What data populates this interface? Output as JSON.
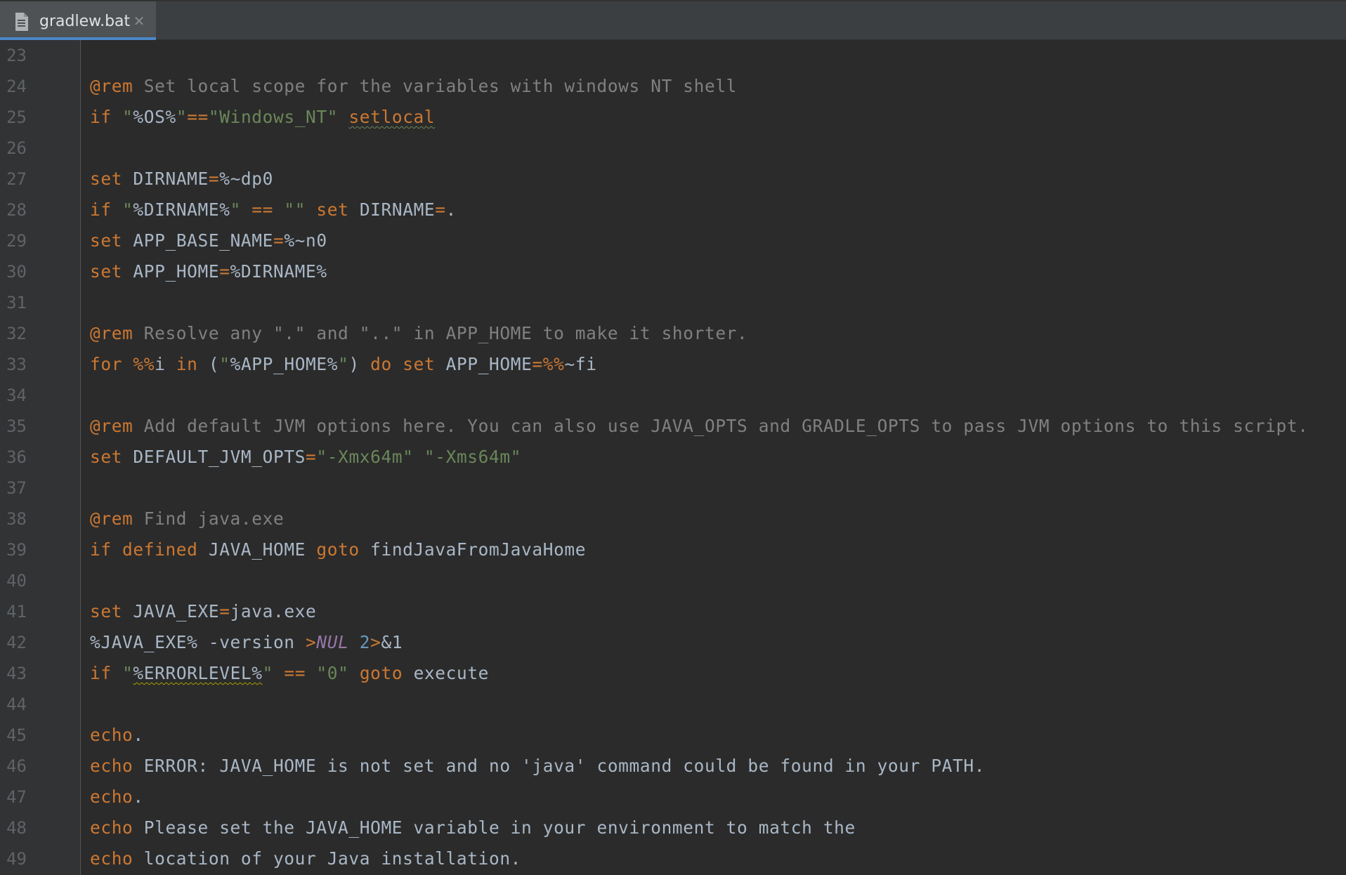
{
  "tab": {
    "filename": "gradlew.bat",
    "icon": "file-icon",
    "close_glyph": "✕"
  },
  "colors": {
    "background": "#2b2b2b",
    "gutter": "#313335",
    "keyword": "#cc7832",
    "comment": "#808080",
    "string": "#6a8759",
    "text": "#a9b7c6",
    "accent": "#4a88c7"
  },
  "lines": [
    {
      "n": "23",
      "tokens": []
    },
    {
      "n": "24",
      "tokens": [
        {
          "t": "rem",
          "v": "@rem"
        },
        {
          "t": "cm",
          "v": " Set local scope for the variables with windows NT shell"
        }
      ]
    },
    {
      "n": "25",
      "tokens": [
        {
          "t": "kw",
          "v": "if"
        },
        {
          "t": "txt",
          "v": " "
        },
        {
          "t": "str",
          "v": "\""
        },
        {
          "t": "var",
          "v": "%OS%"
        },
        {
          "t": "str",
          "v": "\""
        },
        {
          "t": "op",
          "v": "=="
        },
        {
          "t": "str",
          "v": "\"Windows_NT\""
        },
        {
          "t": "txt",
          "v": " "
        },
        {
          "t": "kw-err",
          "v": "setlocal"
        }
      ]
    },
    {
      "n": "26",
      "tokens": []
    },
    {
      "n": "27",
      "tokens": [
        {
          "t": "kw",
          "v": "set"
        },
        {
          "t": "txt",
          "v": " DIRNAME"
        },
        {
          "t": "op",
          "v": "="
        },
        {
          "t": "txt",
          "v": "%~dp0"
        }
      ]
    },
    {
      "n": "28",
      "tokens": [
        {
          "t": "kw",
          "v": "if"
        },
        {
          "t": "txt",
          "v": " "
        },
        {
          "t": "str",
          "v": "\""
        },
        {
          "t": "var",
          "v": "%DIRNAME%"
        },
        {
          "t": "str",
          "v": "\""
        },
        {
          "t": "txt",
          "v": " "
        },
        {
          "t": "op",
          "v": "=="
        },
        {
          "t": "txt",
          "v": " "
        },
        {
          "t": "str",
          "v": "\"\""
        },
        {
          "t": "txt",
          "v": " "
        },
        {
          "t": "kw",
          "v": "set"
        },
        {
          "t": "txt",
          "v": " DIRNAME"
        },
        {
          "t": "op",
          "v": "="
        },
        {
          "t": "txt",
          "v": "."
        }
      ]
    },
    {
      "n": "29",
      "tokens": [
        {
          "t": "kw",
          "v": "set"
        },
        {
          "t": "txt",
          "v": " APP_BASE_NAME"
        },
        {
          "t": "op",
          "v": "="
        },
        {
          "t": "txt",
          "v": "%~n0"
        }
      ]
    },
    {
      "n": "30",
      "tokens": [
        {
          "t": "kw",
          "v": "set"
        },
        {
          "t": "txt",
          "v": " APP_HOME"
        },
        {
          "t": "op",
          "v": "="
        },
        {
          "t": "txt",
          "v": "%DIRNAME%"
        }
      ]
    },
    {
      "n": "31",
      "tokens": []
    },
    {
      "n": "32",
      "tokens": [
        {
          "t": "rem",
          "v": "@rem"
        },
        {
          "t": "cm",
          "v": " Resolve any \".\" and \"..\" in APP_HOME to make it shorter."
        }
      ]
    },
    {
      "n": "33",
      "tokens": [
        {
          "t": "kw",
          "v": "for"
        },
        {
          "t": "txt",
          "v": " "
        },
        {
          "t": "op",
          "v": "%%"
        },
        {
          "t": "txt",
          "v": "i "
        },
        {
          "t": "kw",
          "v": "in"
        },
        {
          "t": "txt",
          "v": " ("
        },
        {
          "t": "str",
          "v": "\""
        },
        {
          "t": "var",
          "v": "%APP_HOME%"
        },
        {
          "t": "str",
          "v": "\""
        },
        {
          "t": "txt",
          "v": ") "
        },
        {
          "t": "kw",
          "v": "do"
        },
        {
          "t": "txt",
          "v": " "
        },
        {
          "t": "kw",
          "v": "set"
        },
        {
          "t": "txt",
          "v": " APP_HOME"
        },
        {
          "t": "op",
          "v": "=%%"
        },
        {
          "t": "txt",
          "v": "~fi"
        }
      ]
    },
    {
      "n": "34",
      "tokens": []
    },
    {
      "n": "35",
      "tokens": [
        {
          "t": "rem",
          "v": "@rem"
        },
        {
          "t": "cm",
          "v": " Add default JVM options here. You can also use JAVA_OPTS and GRADLE_OPTS to pass JVM options to this script."
        }
      ]
    },
    {
      "n": "36",
      "tokens": [
        {
          "t": "kw",
          "v": "set"
        },
        {
          "t": "txt",
          "v": " DEFAULT_JVM_OPTS"
        },
        {
          "t": "op",
          "v": "="
        },
        {
          "t": "str",
          "v": "\"-Xmx64m\" \"-Xms64m\""
        }
      ]
    },
    {
      "n": "37",
      "tokens": []
    },
    {
      "n": "38",
      "tokens": [
        {
          "t": "rem",
          "v": "@rem"
        },
        {
          "t": "cm",
          "v": " Find java.exe"
        }
      ]
    },
    {
      "n": "39",
      "tokens": [
        {
          "t": "kw",
          "v": "if defined"
        },
        {
          "t": "txt",
          "v": " JAVA_HOME "
        },
        {
          "t": "kw",
          "v": "goto"
        },
        {
          "t": "txt",
          "v": " findJavaFromJavaHome"
        }
      ]
    },
    {
      "n": "40",
      "tokens": []
    },
    {
      "n": "41",
      "tokens": [
        {
          "t": "kw",
          "v": "set"
        },
        {
          "t": "txt",
          "v": " JAVA_EXE"
        },
        {
          "t": "op",
          "v": "="
        },
        {
          "t": "txt",
          "v": "java.exe"
        }
      ]
    },
    {
      "n": "42",
      "tokens": [
        {
          "t": "txt",
          "v": "%JAVA_EXE% -version "
        },
        {
          "t": "op",
          "v": ">"
        },
        {
          "t": "nul",
          "v": "NUL"
        },
        {
          "t": "txt",
          "v": " "
        },
        {
          "t": "num",
          "v": "2"
        },
        {
          "t": "op",
          "v": ">"
        },
        {
          "t": "txt",
          "v": "&1"
        }
      ]
    },
    {
      "n": "43",
      "tokens": [
        {
          "t": "kw",
          "v": "if"
        },
        {
          "t": "txt",
          "v": " "
        },
        {
          "t": "str",
          "v": "\""
        },
        {
          "t": "var-warn",
          "v": "%ERRORLEVEL%"
        },
        {
          "t": "str",
          "v": "\""
        },
        {
          "t": "txt",
          "v": " "
        },
        {
          "t": "op",
          "v": "=="
        },
        {
          "t": "txt",
          "v": " "
        },
        {
          "t": "str",
          "v": "\"0\""
        },
        {
          "t": "txt",
          "v": " "
        },
        {
          "t": "kw",
          "v": "goto"
        },
        {
          "t": "txt",
          "v": " execute"
        }
      ]
    },
    {
      "n": "44",
      "tokens": []
    },
    {
      "n": "45",
      "tokens": [
        {
          "t": "kw",
          "v": "echo"
        },
        {
          "t": "txt",
          "v": "."
        }
      ]
    },
    {
      "n": "46",
      "tokens": [
        {
          "t": "kw",
          "v": "echo"
        },
        {
          "t": "txt",
          "v": " ERROR: JAVA_HOME is not set and no 'java' command could be found in your PATH."
        }
      ]
    },
    {
      "n": "47",
      "tokens": [
        {
          "t": "kw",
          "v": "echo"
        },
        {
          "t": "txt",
          "v": "."
        }
      ]
    },
    {
      "n": "48",
      "tokens": [
        {
          "t": "kw",
          "v": "echo"
        },
        {
          "t": "txt",
          "v": " Please set the JAVA_HOME variable in your environment to match the"
        }
      ]
    },
    {
      "n": "49",
      "tokens": [
        {
          "t": "kw",
          "v": "echo"
        },
        {
          "t": "txt",
          "v": " location of your Java installation."
        }
      ]
    }
  ]
}
